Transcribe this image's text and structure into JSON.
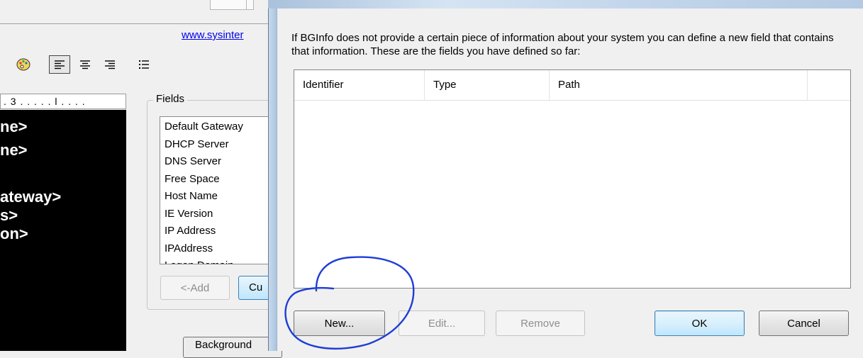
{
  "background_window": {
    "link": "www.sysinter",
    "ruler_text": ". 3 . . . . . l . . . .",
    "editor_lines": [
      "ne>",
      "ne>",
      "",
      "ateway>",
      "s>",
      "on>"
    ],
    "fields_group_label": "Fields",
    "fields": [
      "Default Gateway",
      "DHCP Server",
      "DNS Server",
      "Free Space",
      "Host Name",
      "IE Version",
      "IP Address",
      "IPAddress",
      "Logon Domain"
    ],
    "add_button": "<-Add",
    "custom_button": "Cu",
    "background_button": "Background"
  },
  "dialog": {
    "description": "If BGInfo does not provide a certain piece of information about your system you can define a new field that contains that information. These are the fields you have defined so far:",
    "columns": [
      "Identifier",
      "Type",
      "Path"
    ],
    "buttons": {
      "new": "New...",
      "edit": "Edit...",
      "remove": "Remove",
      "ok": "OK",
      "cancel": "Cancel"
    }
  },
  "icons": {
    "palette": "palette-icon",
    "align_left": "align-left-icon",
    "align_center": "align-center-icon",
    "align_right": "align-right-icon",
    "bullets": "bullet-list-icon"
  },
  "colors": {
    "link": "#0000ee",
    "default_button_border": "#3c7fb1",
    "annotation": "#1f3dd6"
  }
}
